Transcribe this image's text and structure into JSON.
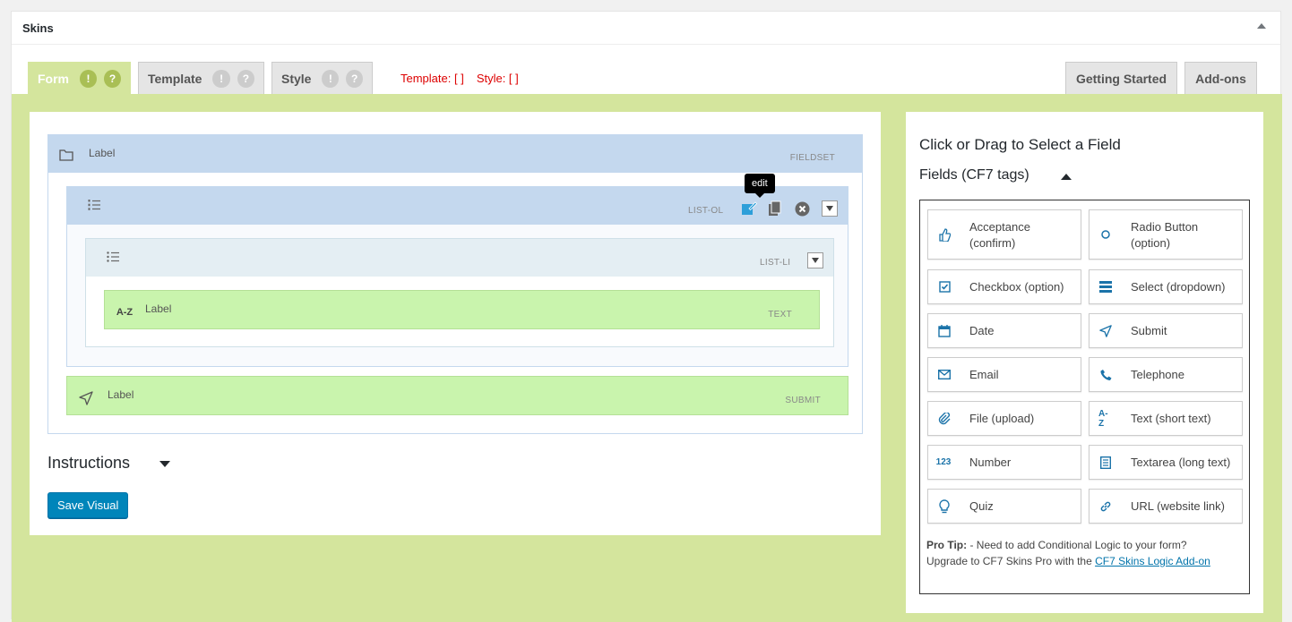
{
  "postbox": {
    "title": "Skins"
  },
  "tabs": [
    {
      "label": "Form",
      "active": true
    },
    {
      "label": "Template",
      "active": false
    },
    {
      "label": "Style",
      "active": false
    }
  ],
  "tab_badges": {
    "info": "!",
    "help": "?"
  },
  "status": {
    "template": "Template: [ ]",
    "style": "Style: [ ]"
  },
  "right_tabs": {
    "getting_started": "Getting Started",
    "addons": "Add-ons"
  },
  "visual": {
    "fieldset": {
      "label": "Label",
      "type": "FIELDSET"
    },
    "list_ol": {
      "type": "LIST-OL",
      "tooltip": "edit"
    },
    "list_li": {
      "type": "LIST-LI"
    },
    "text": {
      "icon_text": "A-Z",
      "label": "Label",
      "type": "TEXT"
    },
    "submit": {
      "label": "Label",
      "type": "SUBMIT"
    }
  },
  "instructions": {
    "label": "Instructions"
  },
  "save_button": "Save Visual",
  "right_panel": {
    "title": "Click or Drag to Select a Field",
    "subtitle": "Fields (CF7 tags)",
    "fields": [
      {
        "label": "Acceptance (confirm)",
        "icon": "thumbs-up-icon"
      },
      {
        "label": "Radio Button (option)",
        "icon": "radio-icon"
      },
      {
        "label": "Checkbox (option)",
        "icon": "checkbox-icon"
      },
      {
        "label": "Select (dropdown)",
        "icon": "list-icon"
      },
      {
        "label": "Date",
        "icon": "calendar-icon"
      },
      {
        "label": "Submit",
        "icon": "send-icon"
      },
      {
        "label": "Email",
        "icon": "envelope-icon"
      },
      {
        "label": "Telephone",
        "icon": "phone-icon"
      },
      {
        "label": "File (upload)",
        "icon": "paperclip-icon"
      },
      {
        "label": "Text (short text)",
        "icon": "az-icon",
        "icon_text": "A-Z"
      },
      {
        "label": "Number",
        "icon": "number-icon",
        "icon_text": "123"
      },
      {
        "label": "Textarea (long text)",
        "icon": "textarea-icon"
      },
      {
        "label": "Quiz",
        "icon": "lightbulb-icon"
      },
      {
        "label": "URL (website link)",
        "icon": "link-icon"
      }
    ],
    "protip": {
      "label": "Pro Tip:",
      "text": " - Need to add Conditional Logic to your form? Upgrade to CF7 Skins Pro with the ",
      "link": "CF7 Skins Logic Add-on"
    }
  },
  "colors": {
    "green_bg": "#d4e59d",
    "blue_header": "#c4d8ee",
    "green_field": "#c9f4ad",
    "accent_blue": "#0085ba",
    "status_red": "#dd0000"
  }
}
